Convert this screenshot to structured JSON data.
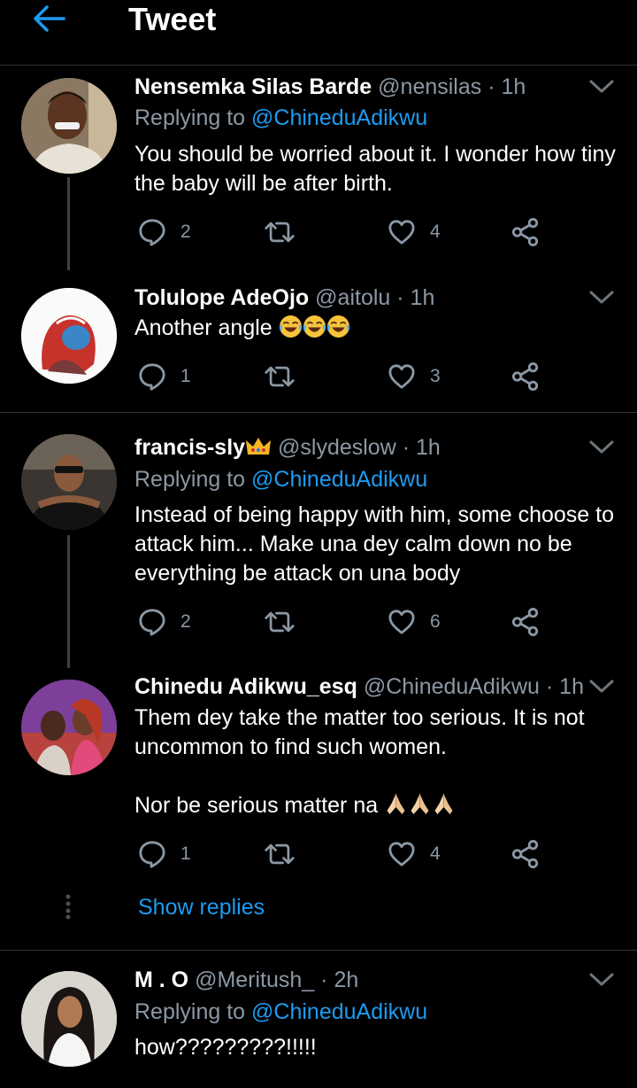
{
  "header": {
    "title": "Tweet"
  },
  "tweets": [
    {
      "name": "Nensemka Silas Barde",
      "handle": "@nensilas",
      "time": "· 1h",
      "replying_prefix": "Replying to",
      "replying_to": "@ChineduAdikwu",
      "text": "You should be worried about it. I wonder how tiny the baby will be after birth.",
      "replies": "2",
      "likes": "4"
    },
    {
      "name": "Tolulope AdeOjo",
      "handle": "@aitolu",
      "time": "· 1h",
      "text": "Another angle",
      "emoji": [
        "face-with-tears-of-joy",
        "face-with-tears-of-joy",
        "face-with-tears-of-joy"
      ],
      "replies": "1",
      "likes": "3"
    },
    {
      "name": "francis-sly",
      "name_badge": "crown-emoji",
      "handle": "@slydeslow",
      "time": "· 1h",
      "replying_prefix": "Replying to",
      "replying_to": "@ChineduAdikwu",
      "text": "Instead of being happy with him, some choose to attack him... Make una dey calm down no be everything be attack on una body",
      "replies": "2",
      "likes": "6"
    },
    {
      "name": "Chinedu Adikwu_esq",
      "handle": "@ChineduAdikwu",
      "time": "· 1h",
      "text": "Them dey take the matter too serious. It is not uncommon to find such women.",
      "text2": "Nor be serious matter na",
      "emoji": [
        "folded-hands",
        "folded-hands",
        "folded-hands"
      ],
      "replies": "1",
      "likes": "4",
      "show_replies": "Show replies"
    },
    {
      "name": "M . O",
      "handle": "@Meritush_",
      "time": "· 2h",
      "replying_prefix": "Replying to",
      "replying_to": "@ChineduAdikwu",
      "text": "how?????????!!!!!"
    }
  ],
  "colors": {
    "background": "#000000",
    "accent": "#1d9bf0",
    "secondary_text": "#8b98a5",
    "divider": "#2f3336"
  },
  "icons": [
    "back-arrow-icon",
    "chevron-down-icon",
    "reply-icon",
    "retweet-icon",
    "like-icon",
    "share-icon"
  ]
}
